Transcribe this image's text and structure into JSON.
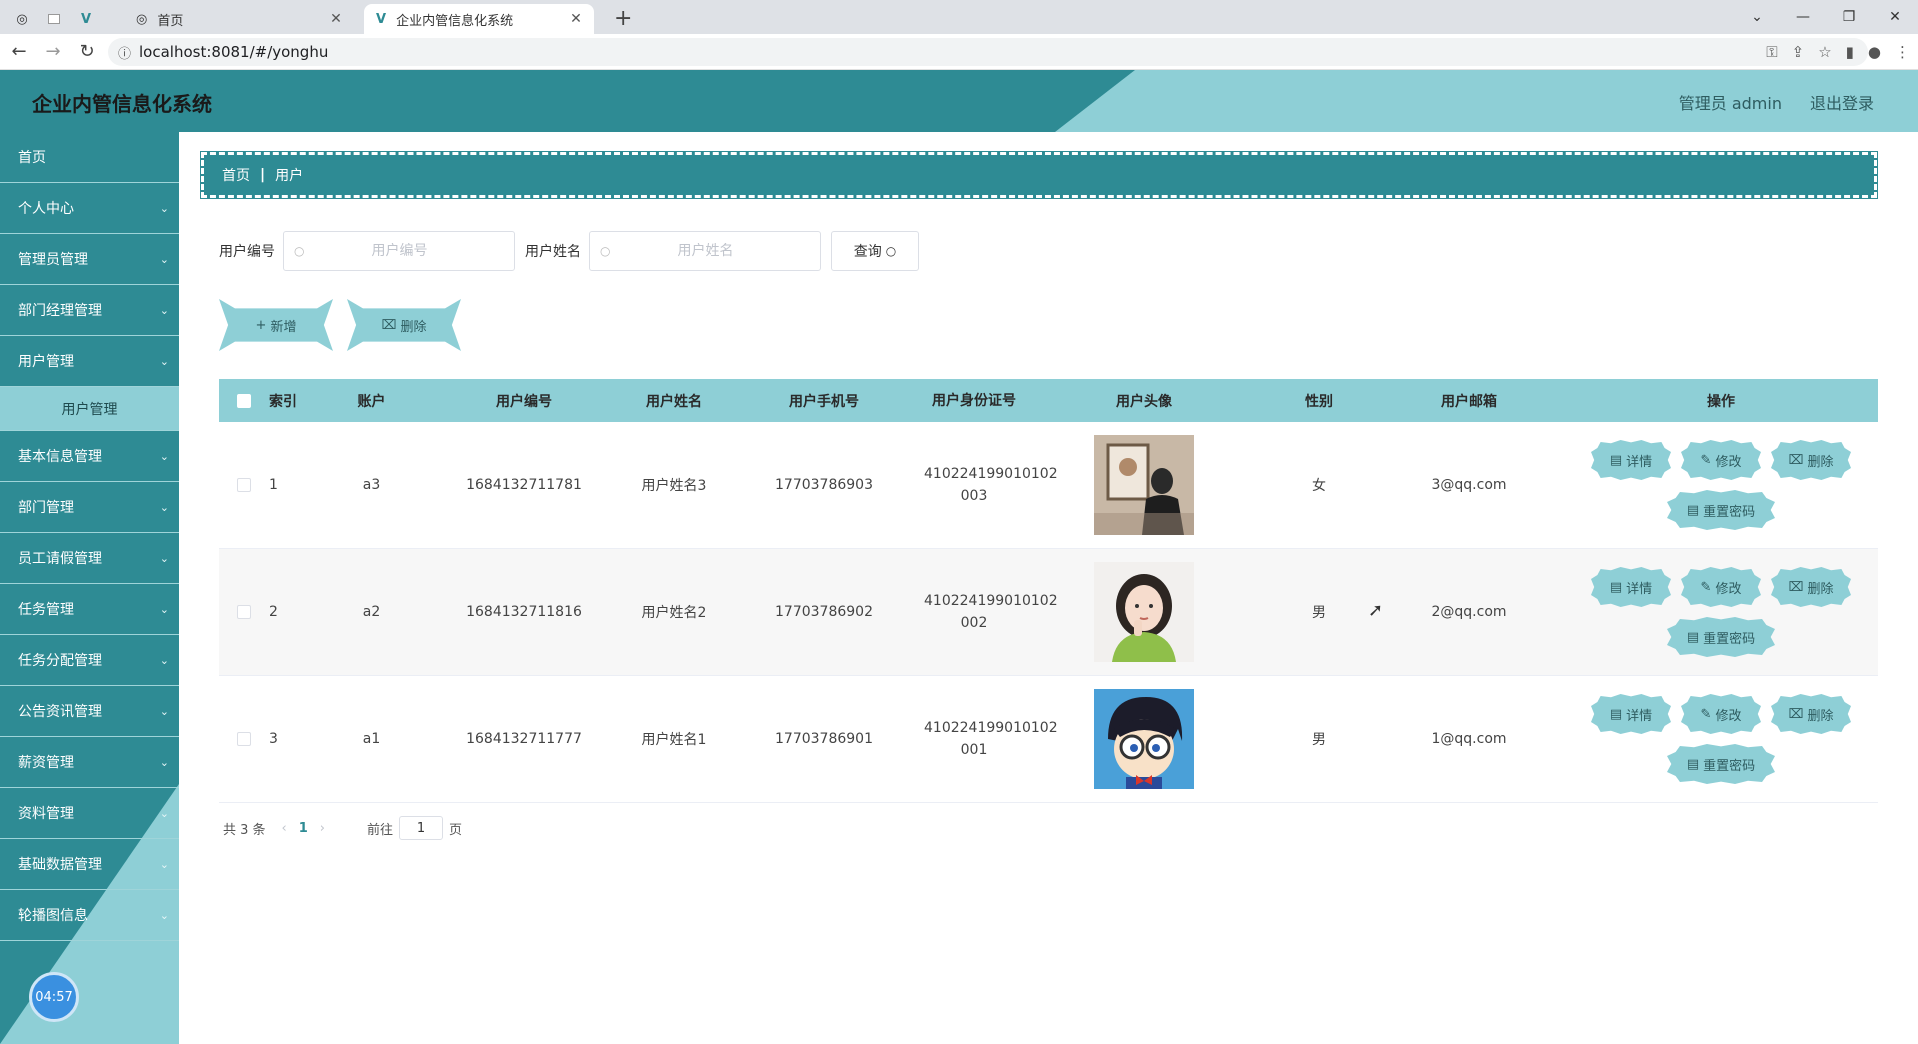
{
  "browser": {
    "tabs": [
      {
        "title": "",
        "icon": "globe-icon"
      },
      {
        "title": "",
        "icon": "blank-page-icon"
      },
      {
        "title": "",
        "icon": "vue-logo-icon"
      },
      {
        "title": "首页",
        "icon": "globe-icon"
      },
      {
        "title": "企业内管信息化系统",
        "icon": "vue-logo-icon",
        "active": true
      }
    ],
    "url": "localhost:8081/#/yonghu"
  },
  "header": {
    "title": "企业内管信息化系统",
    "user_label": "管理员 admin",
    "logout_label": "退出登录"
  },
  "sidebar": {
    "items": [
      {
        "label": "首页",
        "has_chevron": false
      },
      {
        "label": "个人中心",
        "has_chevron": true
      },
      {
        "label": "管理员管理",
        "has_chevron": true
      },
      {
        "label": "部门经理管理",
        "has_chevron": true
      },
      {
        "label": "用户管理",
        "has_chevron": true,
        "expanded": true
      },
      {
        "label": "基本信息管理",
        "has_chevron": true
      },
      {
        "label": "部门管理",
        "has_chevron": true
      },
      {
        "label": "员工请假管理",
        "has_chevron": true
      },
      {
        "label": "任务管理",
        "has_chevron": true
      },
      {
        "label": "任务分配管理",
        "has_chevron": true
      },
      {
        "label": "公告资讯管理",
        "has_chevron": true
      },
      {
        "label": "薪资管理",
        "has_chevron": true
      },
      {
        "label": "资料管理",
        "has_chevron": true
      },
      {
        "label": "基础数据管理",
        "has_chevron": true
      },
      {
        "label": "轮播图信息",
        "has_chevron": true
      }
    ],
    "sub_item": "用户管理",
    "clock": "04:57"
  },
  "breadcrumb": {
    "home": "首页",
    "current": "用户"
  },
  "search": {
    "uid_label": "用户编号",
    "uid_placeholder": "用户编号",
    "name_label": "用户姓名",
    "name_placeholder": "用户姓名",
    "query_label": "查询"
  },
  "actions": {
    "add_label": "新增",
    "delete_label": "删除"
  },
  "table": {
    "headers": [
      "索引",
      "账户",
      "用户编号",
      "用户姓名",
      "用户手机号",
      "用户身份证号",
      "用户头像",
      "性别",
      "用户邮箱",
      "操作"
    ],
    "rows": [
      {
        "index": "1",
        "account": "a3",
        "uid": "1684132711781",
        "name": "用户姓名3",
        "phone": "17703786903",
        "idcard_1": "410224199010102",
        "idcard_2": "003",
        "gender": "女",
        "email": "3@qq.com"
      },
      {
        "index": "2",
        "account": "a2",
        "uid": "1684132711816",
        "name": "用户姓名2",
        "phone": "17703786902",
        "idcard_1": "410224199010102",
        "idcard_2": "002",
        "gender": "男",
        "email": "2@qq.com"
      },
      {
        "index": "3",
        "account": "a1",
        "uid": "1684132711777",
        "name": "用户姓名1",
        "phone": "17703786901",
        "idcard_1": "410224199010102",
        "idcard_2": "001",
        "gender": "男",
        "email": "1@qq.com"
      }
    ],
    "ops": {
      "detail": "详情",
      "edit": "修改",
      "delete": "删除",
      "reset": "重置密码"
    }
  },
  "pager": {
    "total": "共 3 条",
    "current": "1",
    "goto_label": "前往",
    "page_value": "1",
    "page_suffix": "页"
  },
  "colors": {
    "primary": "#2e8b94",
    "accent": "#8ecfd6"
  }
}
